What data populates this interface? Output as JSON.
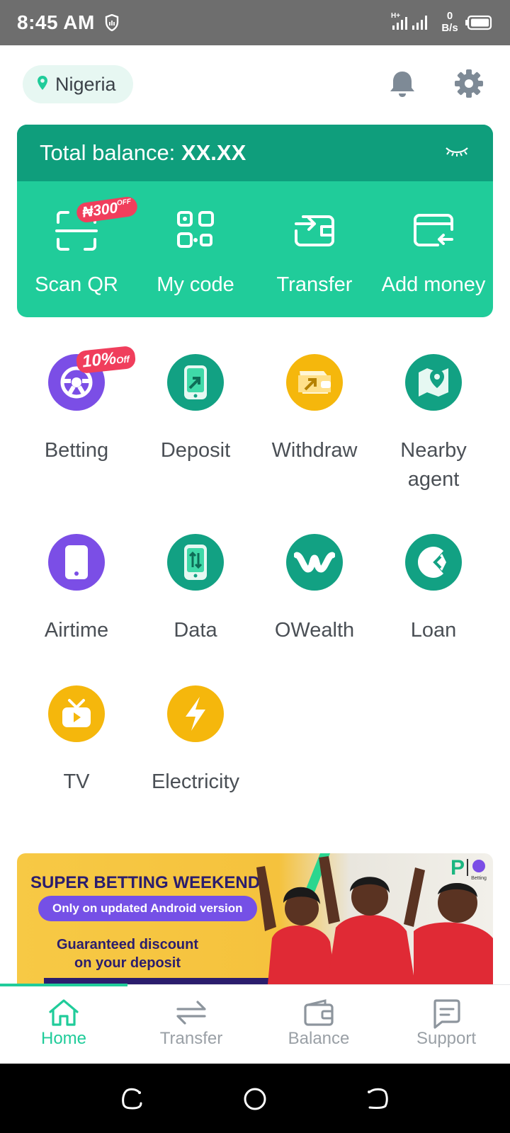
{
  "status_bar": {
    "time": "8:45 AM",
    "net_speed_value": "0",
    "net_speed_unit": "B/s",
    "signal_label": "H+"
  },
  "header": {
    "location": "Nigeria"
  },
  "balance": {
    "label": "Total balance:",
    "value": "XX.XX"
  },
  "quick_actions": [
    {
      "label": "Scan QR",
      "icon": "scan-qr-icon",
      "badge": "₦300",
      "badge_suffix": "OFF"
    },
    {
      "label": "My code",
      "icon": "qr-code-icon"
    },
    {
      "label": "Transfer",
      "icon": "transfer-card-icon"
    },
    {
      "label": "Add money",
      "icon": "add-money-card-icon"
    }
  ],
  "services": [
    {
      "label": "Betting",
      "icon": "betting-icon",
      "color": "#7b4ee6",
      "badge": "10%",
      "badge_suffix": "Off"
    },
    {
      "label": "Deposit",
      "icon": "deposit-icon",
      "color": "#12a183"
    },
    {
      "label": "Withdraw",
      "icon": "withdraw-icon",
      "color": "#f5b70c"
    },
    {
      "label": "Nearby agent",
      "icon": "nearby-agent-icon",
      "color": "#12a183"
    },
    {
      "label": "Airtime",
      "icon": "airtime-icon",
      "color": "#7b4ee6"
    },
    {
      "label": "Data",
      "icon": "data-icon",
      "color": "#12a183"
    },
    {
      "label": "OWealth",
      "icon": "owealth-icon",
      "color": "#12a183"
    },
    {
      "label": "Loan",
      "icon": "loan-icon",
      "color": "#12a183"
    },
    {
      "label": "TV",
      "icon": "tv-icon",
      "color": "#f5b70c"
    },
    {
      "label": "Electricity",
      "icon": "electricity-icon",
      "color": "#f5b70c"
    }
  ],
  "banner": {
    "title": "SUPER BETTING WEEKEND",
    "pill": "Only on updated Android version",
    "line1": "Guaranteed discount",
    "line2": "on your deposit",
    "logo_text": "Betting"
  },
  "bottom_nav": [
    {
      "label": "Home",
      "icon": "home-icon",
      "active": true
    },
    {
      "label": "Transfer",
      "icon": "transfer-arrows-icon",
      "active": false
    },
    {
      "label": "Balance",
      "icon": "wallet-icon",
      "active": false
    },
    {
      "label": "Support",
      "icon": "chat-icon",
      "active": false
    }
  ],
  "colors": {
    "brand": "#20cc9a",
    "brand_dark": "#0f9e7c",
    "purple": "#7b4ee6",
    "yellow": "#f5b70c",
    "badge": "#f03e5c"
  }
}
